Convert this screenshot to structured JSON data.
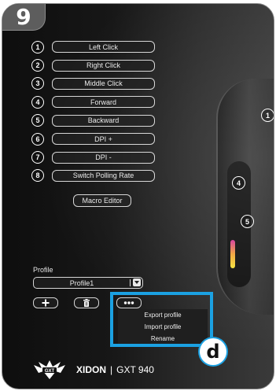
{
  "step": {
    "number": "9",
    "sub_step": "d"
  },
  "button_assignments": [
    {
      "num": "1",
      "label": "Left Click"
    },
    {
      "num": "2",
      "label": "Right Click"
    },
    {
      "num": "3",
      "label": "Middle Click"
    },
    {
      "num": "4",
      "label": "Forward"
    },
    {
      "num": "5",
      "label": "Backward"
    },
    {
      "num": "6",
      "label": "DPI +"
    },
    {
      "num": "7",
      "label": "DPI -"
    },
    {
      "num": "8",
      "label": "Switch Polling Rate"
    }
  ],
  "macro_editor_label": "Macro Editor",
  "mouse_callouts": [
    "1",
    "4",
    "5"
  ],
  "profile": {
    "label": "Profile",
    "selected": "Profile1",
    "add_icon": "plus-icon",
    "delete_icon": "trash-icon",
    "more_icon": "ellipsis-icon"
  },
  "profile_menu": [
    "Export profile",
    "Import profile",
    "Rename"
  ],
  "brand": {
    "name": "XIDON",
    "separator": "|",
    "model": "GXT 940",
    "logo_text": "GXT"
  },
  "colors": {
    "highlight": "#1ba1e2",
    "panel": "#111111"
  }
}
